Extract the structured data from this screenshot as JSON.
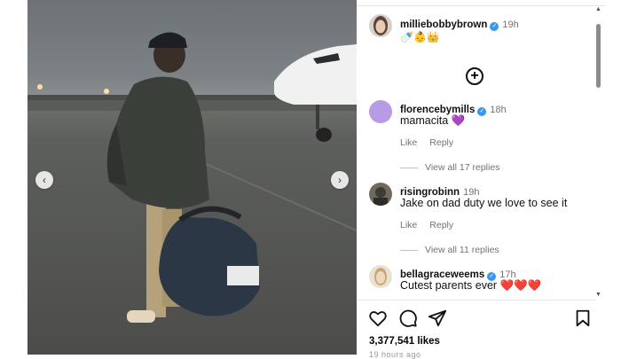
{
  "post": {
    "author": "milliebobbybrown",
    "time": "19h",
    "caption_emojis": "🍼👶👑"
  },
  "photo": {
    "prev_icon": "chevron-left-icon",
    "next_icon": "chevron-right-icon",
    "prev_glyph": "‹",
    "next_glyph": "›"
  },
  "comments": [
    {
      "username": "florencebymills",
      "time": "18h",
      "text": "mamacita 💜",
      "like_label": "Like",
      "reply_label": "Reply",
      "view_replies": "View all 17 replies"
    },
    {
      "username": "risingrobinn",
      "time": "19h",
      "text": "Jake on dad duty we love to see it",
      "like_label": "Like",
      "reply_label": "Reply",
      "view_replies": "View all 11 replies"
    },
    {
      "username": "bellagraceweems",
      "time": "17h",
      "text": "Cutest parents ever ❤️❤️❤️"
    }
  ],
  "add_glyph": "+",
  "actions": {
    "like_icon": "heart-icon",
    "comment_icon": "comment-icon",
    "share_icon": "send-icon",
    "save_icon": "bookmark-icon"
  },
  "likes": "3,377,541 likes",
  "posted_ago": "19 hours ago",
  "colors": {
    "verified": "#3897f0",
    "muted": "#737373",
    "comment1_avatar": "#b79be6"
  }
}
